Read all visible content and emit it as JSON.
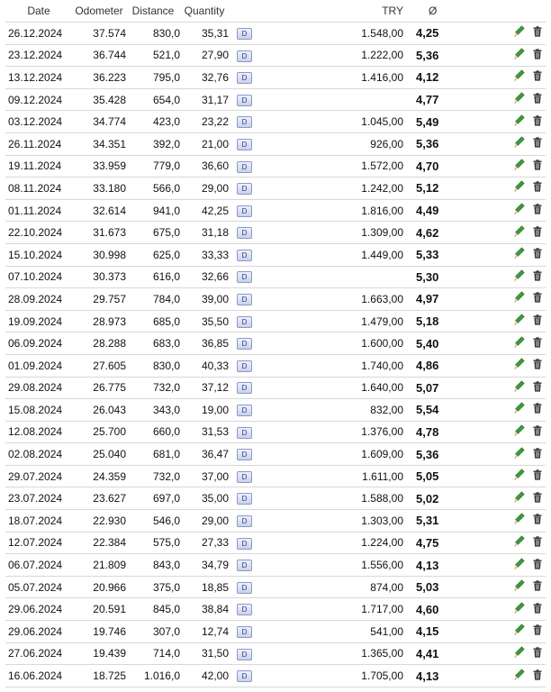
{
  "columns": {
    "date": "Date",
    "odometer": "Odometer",
    "distance": "Distance",
    "quantity": "Quantity",
    "currency": "TRY",
    "average": "Ø"
  },
  "badge_label": "D",
  "icons": {
    "edit": "pencil-icon",
    "delete": "trash-icon"
  },
  "colors": {
    "pencil_body": "#3c9a3c",
    "pencil_tip": "#d04040",
    "trash": "#333333",
    "row_border": "#d8d8d8"
  },
  "rows": [
    {
      "date": "26.12.2024",
      "odometer": "37.574",
      "distance": "830,0",
      "quantity": "35,31",
      "price": "1.548,00",
      "avg": "4,25"
    },
    {
      "date": "23.12.2024",
      "odometer": "36.744",
      "distance": "521,0",
      "quantity": "27,90",
      "price": "1.222,00",
      "avg": "5,36"
    },
    {
      "date": "13.12.2024",
      "odometer": "36.223",
      "distance": "795,0",
      "quantity": "32,76",
      "price": "1.416,00",
      "avg": "4,12"
    },
    {
      "date": "09.12.2024",
      "odometer": "35.428",
      "distance": "654,0",
      "quantity": "31,17",
      "price": "",
      "avg": "4,77"
    },
    {
      "date": "03.12.2024",
      "odometer": "34.774",
      "distance": "423,0",
      "quantity": "23,22",
      "price": "1.045,00",
      "avg": "5,49"
    },
    {
      "date": "26.11.2024",
      "odometer": "34.351",
      "distance": "392,0",
      "quantity": "21,00",
      "price": "926,00",
      "avg": "5,36"
    },
    {
      "date": "19.11.2024",
      "odometer": "33.959",
      "distance": "779,0",
      "quantity": "36,60",
      "price": "1.572,00",
      "avg": "4,70"
    },
    {
      "date": "08.11.2024",
      "odometer": "33.180",
      "distance": "566,0",
      "quantity": "29,00",
      "price": "1.242,00",
      "avg": "5,12"
    },
    {
      "date": "01.11.2024",
      "odometer": "32.614",
      "distance": "941,0",
      "quantity": "42,25",
      "price": "1.816,00",
      "avg": "4,49"
    },
    {
      "date": "22.10.2024",
      "odometer": "31.673",
      "distance": "675,0",
      "quantity": "31,18",
      "price": "1.309,00",
      "avg": "4,62"
    },
    {
      "date": "15.10.2024",
      "odometer": "30.998",
      "distance": "625,0",
      "quantity": "33,33",
      "price": "1.449,00",
      "avg": "5,33"
    },
    {
      "date": "07.10.2024",
      "odometer": "30.373",
      "distance": "616,0",
      "quantity": "32,66",
      "price": "",
      "avg": "5,30"
    },
    {
      "date": "28.09.2024",
      "odometer": "29.757",
      "distance": "784,0",
      "quantity": "39,00",
      "price": "1.663,00",
      "avg": "4,97"
    },
    {
      "date": "19.09.2024",
      "odometer": "28.973",
      "distance": "685,0",
      "quantity": "35,50",
      "price": "1.479,00",
      "avg": "5,18"
    },
    {
      "date": "06.09.2024",
      "odometer": "28.288",
      "distance": "683,0",
      "quantity": "36,85",
      "price": "1.600,00",
      "avg": "5,40"
    },
    {
      "date": "01.09.2024",
      "odometer": "27.605",
      "distance": "830,0",
      "quantity": "40,33",
      "price": "1.740,00",
      "avg": "4,86"
    },
    {
      "date": "29.08.2024",
      "odometer": "26.775",
      "distance": "732,0",
      "quantity": "37,12",
      "price": "1.640,00",
      "avg": "5,07"
    },
    {
      "date": "15.08.2024",
      "odometer": "26.043",
      "distance": "343,0",
      "quantity": "19,00",
      "price": "832,00",
      "avg": "5,54"
    },
    {
      "date": "12.08.2024",
      "odometer": "25.700",
      "distance": "660,0",
      "quantity": "31,53",
      "price": "1.376,00",
      "avg": "4,78"
    },
    {
      "date": "02.08.2024",
      "odometer": "25.040",
      "distance": "681,0",
      "quantity": "36,47",
      "price": "1.609,00",
      "avg": "5,36"
    },
    {
      "date": "29.07.2024",
      "odometer": "24.359",
      "distance": "732,0",
      "quantity": "37,00",
      "price": "1.611,00",
      "avg": "5,05"
    },
    {
      "date": "23.07.2024",
      "odometer": "23.627",
      "distance": "697,0",
      "quantity": "35,00",
      "price": "1.588,00",
      "avg": "5,02"
    },
    {
      "date": "18.07.2024",
      "odometer": "22.930",
      "distance": "546,0",
      "quantity": "29,00",
      "price": "1.303,00",
      "avg": "5,31"
    },
    {
      "date": "12.07.2024",
      "odometer": "22.384",
      "distance": "575,0",
      "quantity": "27,33",
      "price": "1.224,00",
      "avg": "4,75"
    },
    {
      "date": "06.07.2024",
      "odometer": "21.809",
      "distance": "843,0",
      "quantity": "34,79",
      "price": "1.556,00",
      "avg": "4,13"
    },
    {
      "date": "05.07.2024",
      "odometer": "20.966",
      "distance": "375,0",
      "quantity": "18,85",
      "price": "874,00",
      "avg": "5,03"
    },
    {
      "date": "29.06.2024",
      "odometer": "20.591",
      "distance": "845,0",
      "quantity": "38,84",
      "price": "1.717,00",
      "avg": "4,60"
    },
    {
      "date": "29.06.2024",
      "odometer": "19.746",
      "distance": "307,0",
      "quantity": "12,74",
      "price": "541,00",
      "avg": "4,15"
    },
    {
      "date": "27.06.2024",
      "odometer": "19.439",
      "distance": "714,0",
      "quantity": "31,50",
      "price": "1.365,00",
      "avg": "4,41"
    },
    {
      "date": "16.06.2024",
      "odometer": "18.725",
      "distance": "1.016,0",
      "quantity": "42,00",
      "price": "1.705,00",
      "avg": "4,13"
    }
  ]
}
